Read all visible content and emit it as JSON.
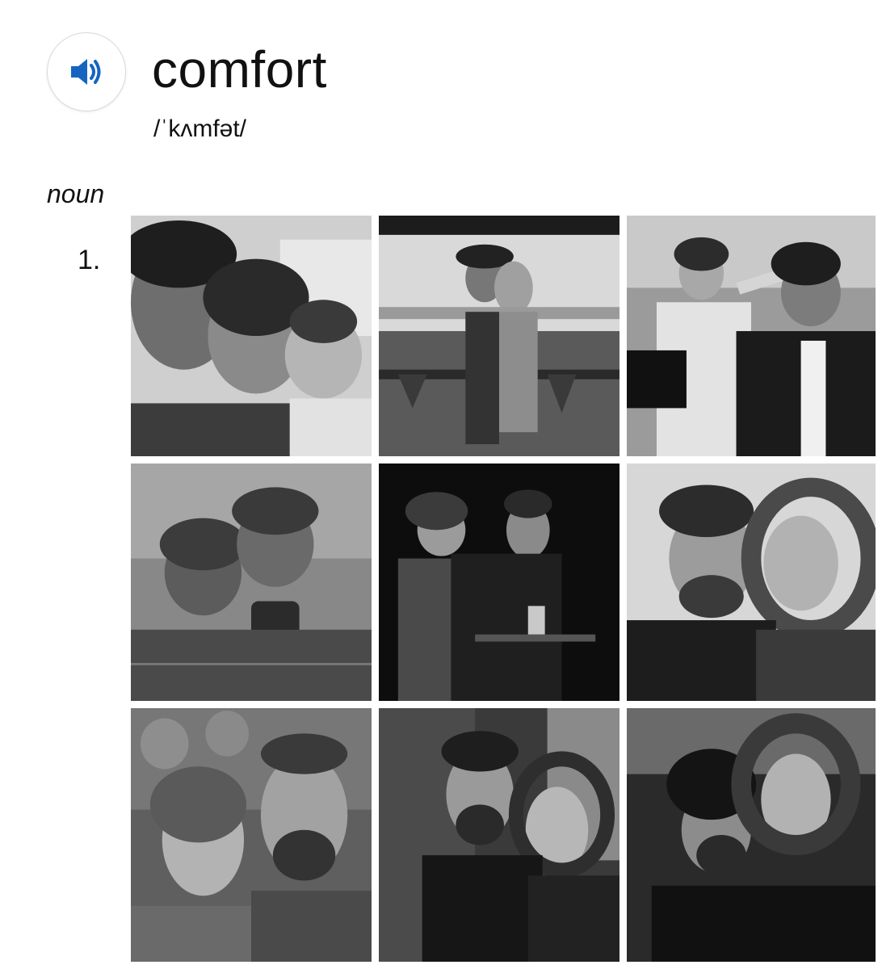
{
  "entry": {
    "word": "comfort",
    "pronunciation": "/ˈkʌmfət/",
    "part_of_speech": "noun",
    "sense_number": "1.",
    "audio_icon": "speaker-icon",
    "accent_color": "#1565c0"
  },
  "photos": [
    {
      "id": "photo-1",
      "tone": "light"
    },
    {
      "id": "photo-2",
      "tone": "light"
    },
    {
      "id": "photo-3",
      "tone": "mid"
    },
    {
      "id": "photo-4",
      "tone": "mid"
    },
    {
      "id": "photo-5",
      "tone": "dark"
    },
    {
      "id": "photo-6",
      "tone": "light"
    },
    {
      "id": "photo-7",
      "tone": "mid"
    },
    {
      "id": "photo-8",
      "tone": "dark"
    },
    {
      "id": "photo-9",
      "tone": "dark"
    }
  ]
}
